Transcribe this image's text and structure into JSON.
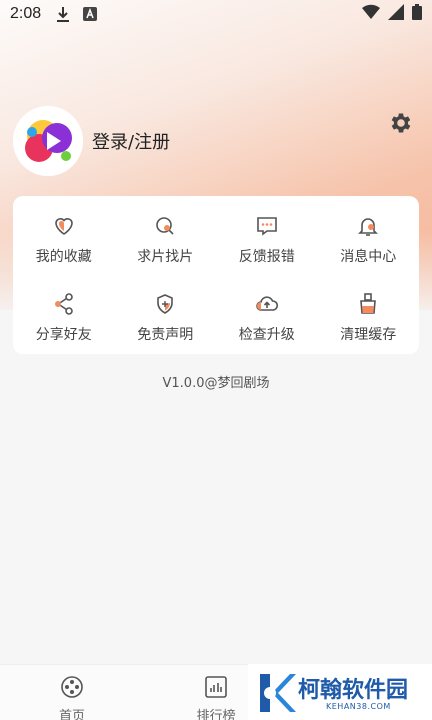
{
  "status_bar": {
    "time": "2:08",
    "icons": [
      "download-icon",
      "a-letter-icon",
      "wifi-icon",
      "cell-signal-icon",
      "battery-icon"
    ]
  },
  "profile": {
    "login_label": "登录/注册",
    "settings_icon": "gear-icon"
  },
  "menu": {
    "items": [
      {
        "label": "我的收藏",
        "icon": "heart-icon"
      },
      {
        "label": "求片找片",
        "icon": "search-film-icon"
      },
      {
        "label": "反馈报错",
        "icon": "feedback-icon"
      },
      {
        "label": "消息中心",
        "icon": "bell-icon"
      },
      {
        "label": "分享好友",
        "icon": "share-icon"
      },
      {
        "label": "免责声明",
        "icon": "shield-icon"
      },
      {
        "label": "检查升级",
        "icon": "cloud-upload-icon"
      },
      {
        "label": "清理缓存",
        "icon": "broom-icon"
      }
    ]
  },
  "version": "V1.0.0@梦回剧场",
  "bottom_nav": {
    "items": [
      {
        "label": "首页",
        "icon": "film-reel-icon"
      },
      {
        "label": "排行榜",
        "icon": "bar-chart-icon"
      }
    ]
  },
  "watermark": {
    "title": "柯翰软件园",
    "subtitle": "KEHAN38.COM"
  },
  "colors": {
    "accent": "#f28c5e",
    "icon_stroke": "#555555",
    "header_gradient_end": "#f5b597"
  }
}
